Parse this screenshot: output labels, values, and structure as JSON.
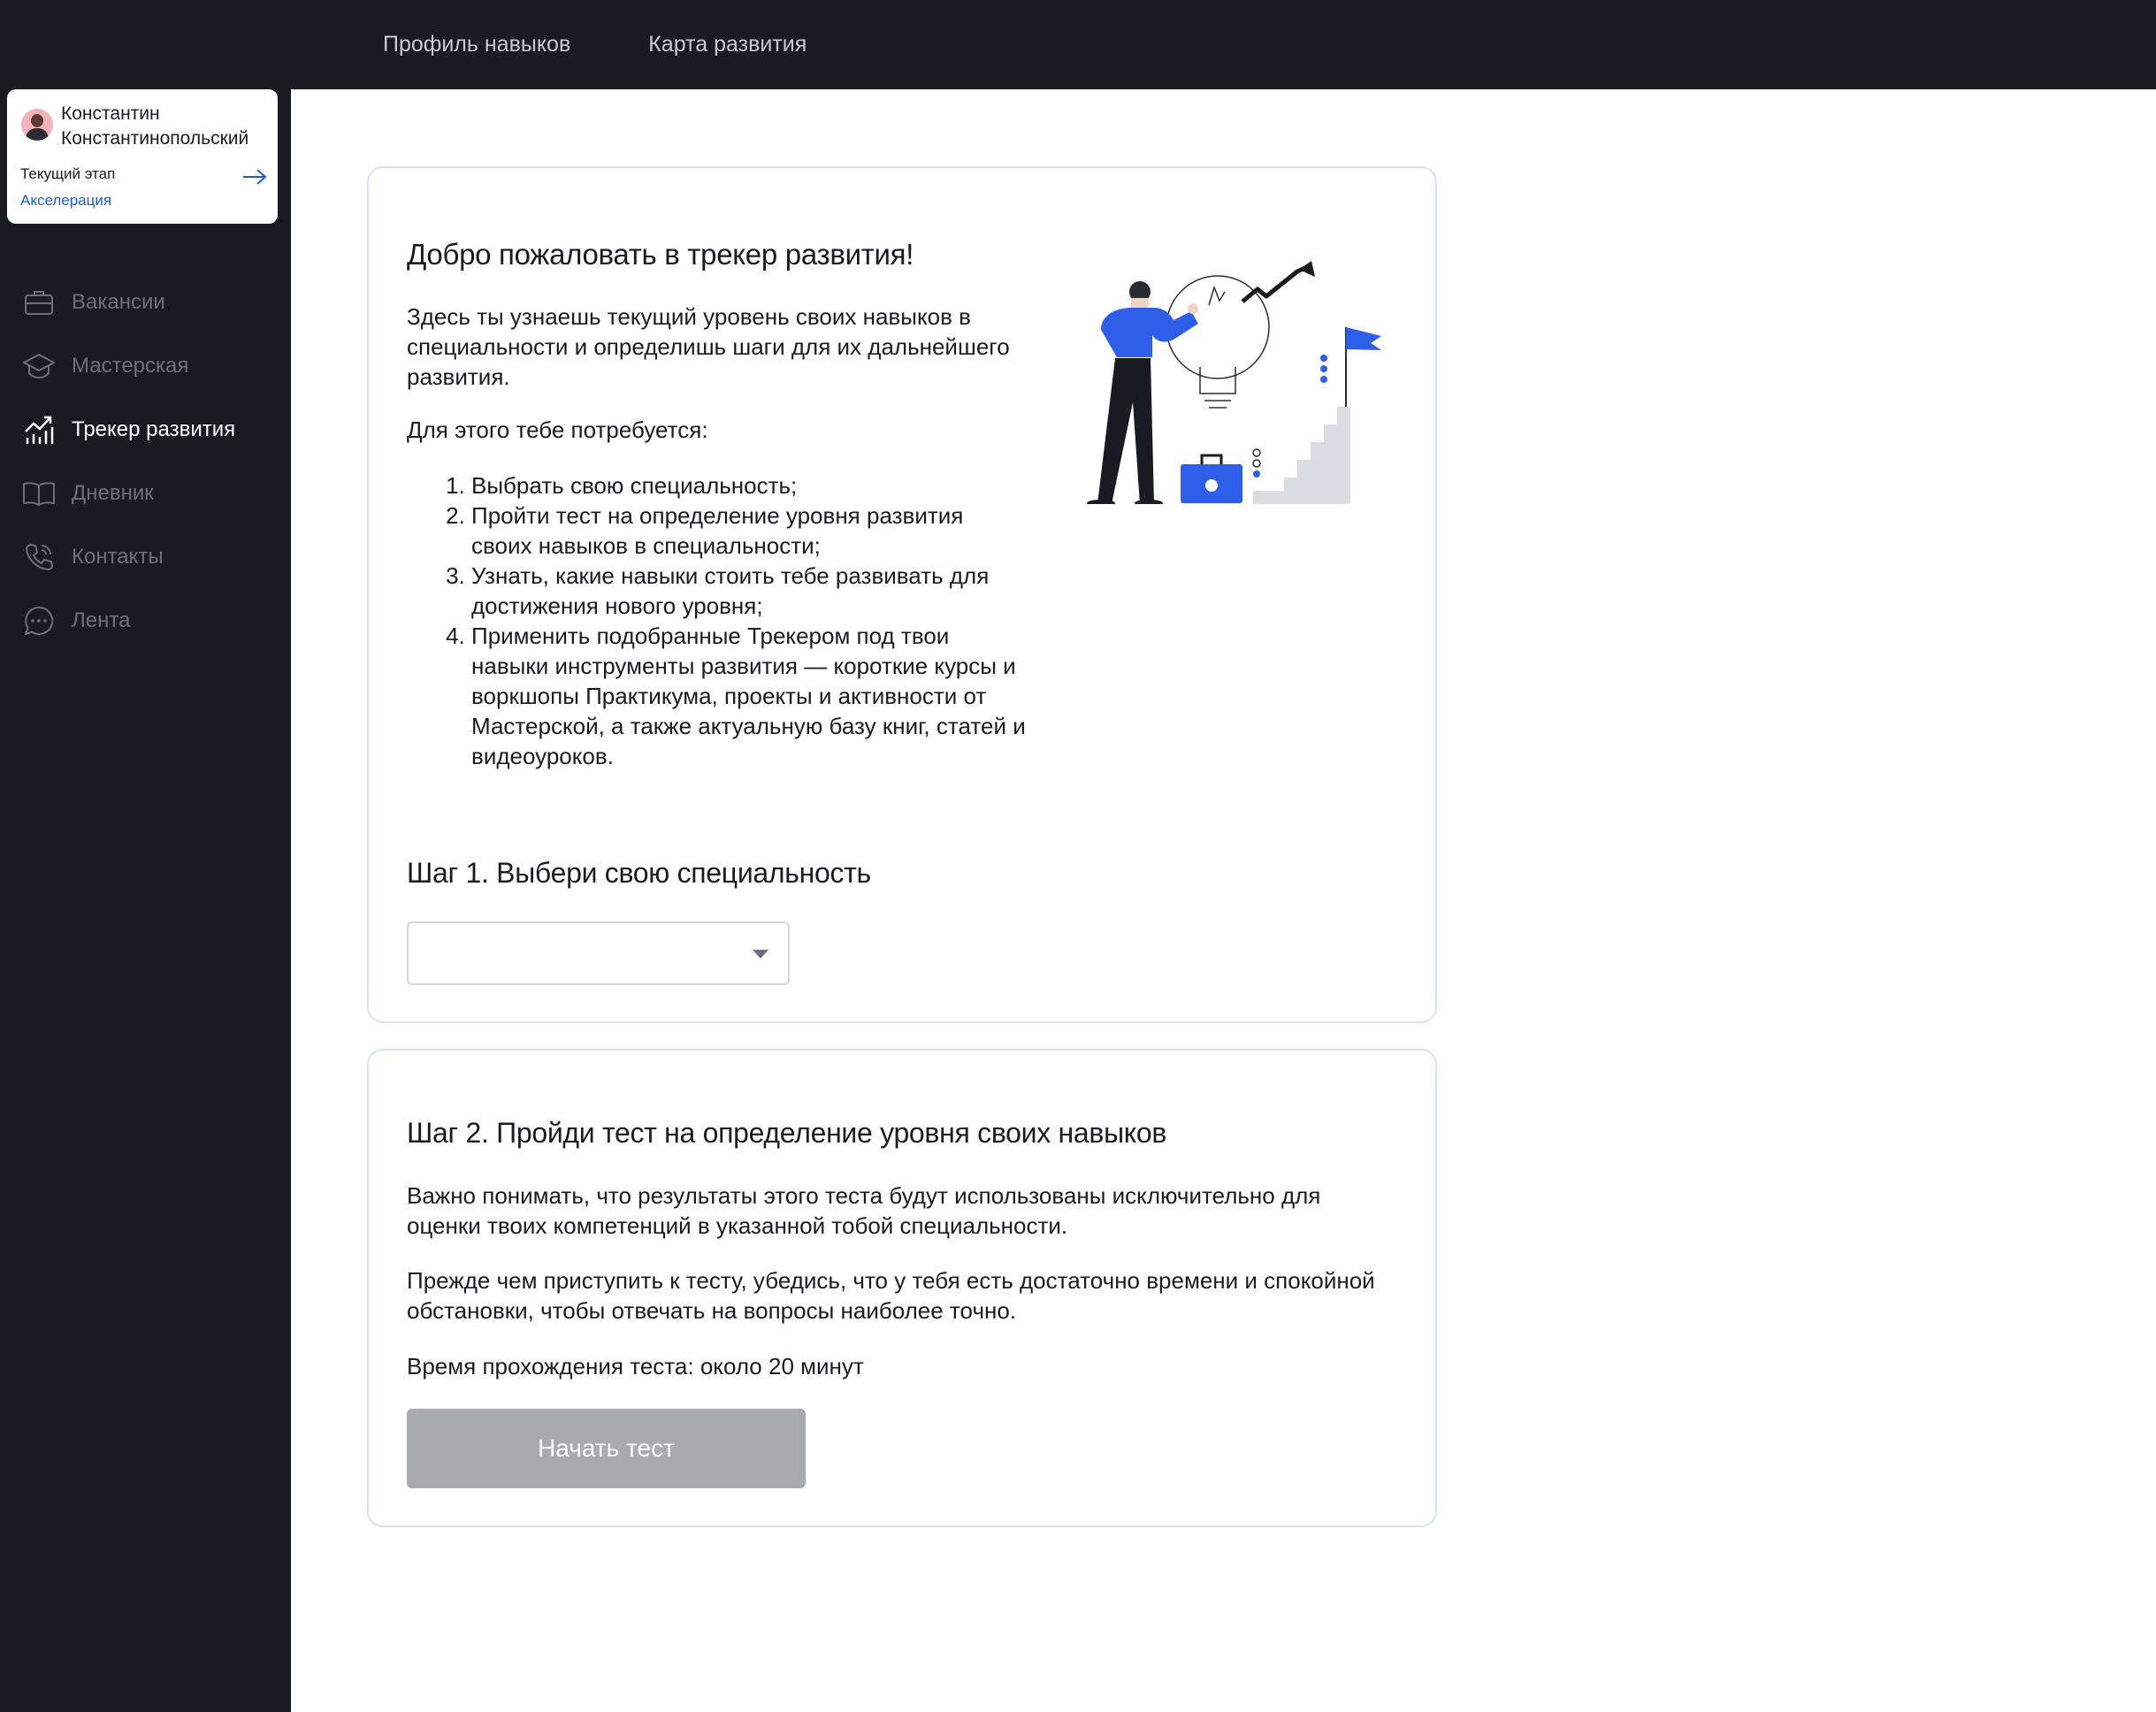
{
  "topnav": {
    "items": [
      {
        "label": "Профиль навыков"
      },
      {
        "label": "Карта развития"
      }
    ]
  },
  "user": {
    "name": "Константин Константинопольский",
    "stage_label": "Текущий этап",
    "stage_value": "Акселерация"
  },
  "sidebar": {
    "items": [
      {
        "label": "Вакансии",
        "icon": "briefcase-icon",
        "active": false
      },
      {
        "label": "Мастерская",
        "icon": "graduation-cap-icon",
        "active": false
      },
      {
        "label": "Трекер развития",
        "icon": "growth-chart-icon",
        "active": true
      },
      {
        "label": "Дневник",
        "icon": "book-icon",
        "active": false
      },
      {
        "label": "Контакты",
        "icon": "phone-icon",
        "active": false
      },
      {
        "label": "Лента",
        "icon": "chat-icon",
        "active": false
      }
    ]
  },
  "welcome": {
    "title": "Добро пожаловать в трекер развития!",
    "intro": "Здесь ты узнаешь текущий уровень своих навыков в специальности и определишь шаги для их дальнейшего развития.",
    "need": "Для этого тебе потребуется:",
    "steps": [
      "Выбрать свою специальность;",
      "Пройти тест на определение уровня развития своих навыков в специальности;",
      "Узнать, какие навыки стоить тебе развивать для достижения нового уровня;",
      "Применить подобранные Трекером под твои навыки инструменты развития — короткие курсы и воркшопы Практикума, проекты и активности от Мастерской, а также актуальную базу книг, статей и видеоуроков."
    ],
    "step1_title": "Шаг 1. Выбери свою специальность",
    "select_value": ""
  },
  "test": {
    "title": "Шаг 2. Пройди тест на определение уровня своих навыков",
    "p1": "Важно понимать, что результаты этого теста будут использованы исключительно для оценки твоих компетенций в указанной тобой специальности.",
    "p2": "Прежде чем приступить к тесту, убедись, что у тебя есть достаточно времени и спокойной обстановки, чтобы отвечать на вопросы наиболее точно.",
    "duration": "Время прохождения теста: около 20 минут",
    "start_label": "Начать тест"
  },
  "colors": {
    "dark_bg": "#1a1b22",
    "accent_blue": "#1d5bd8",
    "illustration_blue": "#2f5ee8",
    "card_border": "#d6e2f5",
    "disabled_button": "#a9aaad"
  }
}
